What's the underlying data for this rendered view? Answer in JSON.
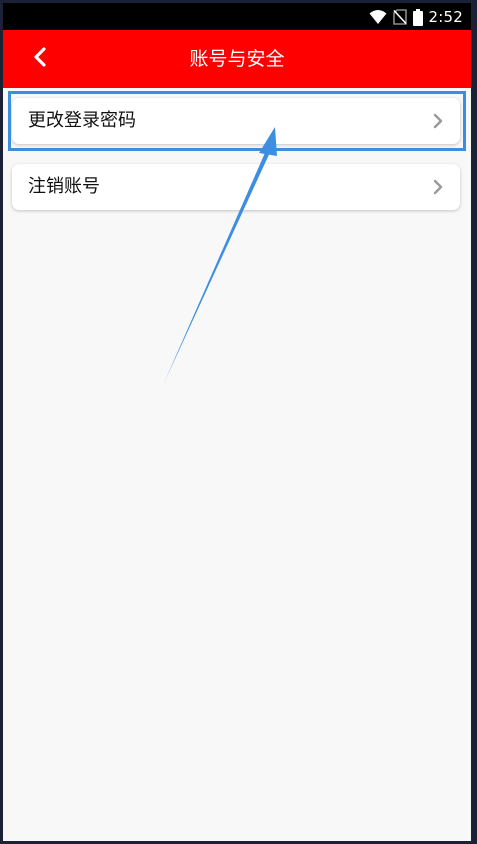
{
  "status_bar": {
    "time": "2:52",
    "icons": [
      "wifi-icon",
      "no-sim-icon",
      "battery-icon"
    ]
  },
  "app_bar": {
    "back_icon": "chevron-left-icon",
    "title": "账号与安全"
  },
  "menu": {
    "items": [
      {
        "label": "更改登录密码",
        "icon": "chevron-right-icon"
      },
      {
        "label": "注销账号",
        "icon": "chevron-right-icon"
      }
    ]
  },
  "colors": {
    "app_bar": "#ff0000",
    "status_bar": "#000000",
    "background": "#f8f8f8",
    "annotation": "#3d8ee0",
    "chevron": "#9a9a9a"
  }
}
